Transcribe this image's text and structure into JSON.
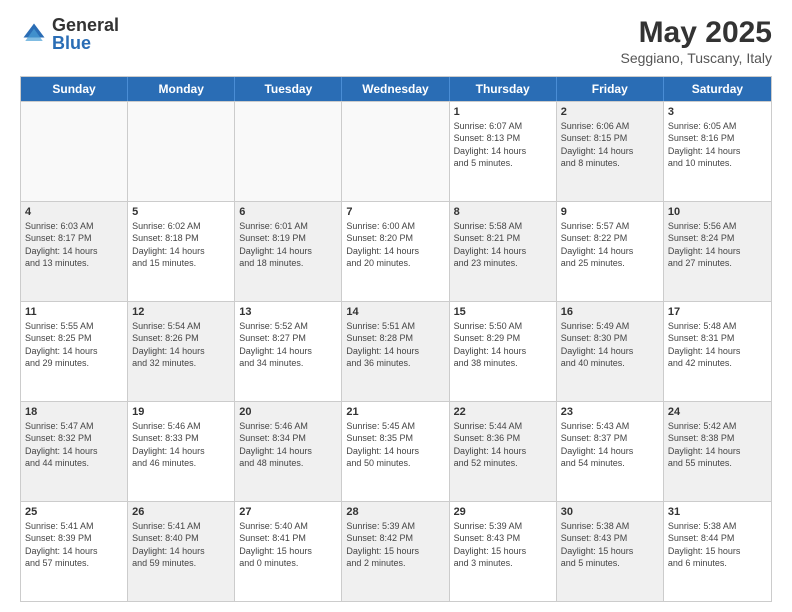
{
  "header": {
    "logo_general": "General",
    "logo_blue": "Blue",
    "title": "May 2025",
    "subtitle": "Seggiano, Tuscany, Italy"
  },
  "calendar": {
    "days": [
      "Sunday",
      "Monday",
      "Tuesday",
      "Wednesday",
      "Thursday",
      "Friday",
      "Saturday"
    ],
    "rows": [
      [
        {
          "num": "",
          "info": "",
          "empty": true
        },
        {
          "num": "",
          "info": "",
          "empty": true
        },
        {
          "num": "",
          "info": "",
          "empty": true
        },
        {
          "num": "",
          "info": "",
          "empty": true
        },
        {
          "num": "1",
          "info": "Sunrise: 6:07 AM\nSunset: 8:13 PM\nDaylight: 14 hours\nand 5 minutes.",
          "shaded": false
        },
        {
          "num": "2",
          "info": "Sunrise: 6:06 AM\nSunset: 8:15 PM\nDaylight: 14 hours\nand 8 minutes.",
          "shaded": true
        },
        {
          "num": "3",
          "info": "Sunrise: 6:05 AM\nSunset: 8:16 PM\nDaylight: 14 hours\nand 10 minutes.",
          "shaded": false
        }
      ],
      [
        {
          "num": "4",
          "info": "Sunrise: 6:03 AM\nSunset: 8:17 PM\nDaylight: 14 hours\nand 13 minutes.",
          "shaded": true
        },
        {
          "num": "5",
          "info": "Sunrise: 6:02 AM\nSunset: 8:18 PM\nDaylight: 14 hours\nand 15 minutes.",
          "shaded": false
        },
        {
          "num": "6",
          "info": "Sunrise: 6:01 AM\nSunset: 8:19 PM\nDaylight: 14 hours\nand 18 minutes.",
          "shaded": true
        },
        {
          "num": "7",
          "info": "Sunrise: 6:00 AM\nSunset: 8:20 PM\nDaylight: 14 hours\nand 20 minutes.",
          "shaded": false
        },
        {
          "num": "8",
          "info": "Sunrise: 5:58 AM\nSunset: 8:21 PM\nDaylight: 14 hours\nand 23 minutes.",
          "shaded": true
        },
        {
          "num": "9",
          "info": "Sunrise: 5:57 AM\nSunset: 8:22 PM\nDaylight: 14 hours\nand 25 minutes.",
          "shaded": false
        },
        {
          "num": "10",
          "info": "Sunrise: 5:56 AM\nSunset: 8:24 PM\nDaylight: 14 hours\nand 27 minutes.",
          "shaded": true
        }
      ],
      [
        {
          "num": "11",
          "info": "Sunrise: 5:55 AM\nSunset: 8:25 PM\nDaylight: 14 hours\nand 29 minutes.",
          "shaded": false
        },
        {
          "num": "12",
          "info": "Sunrise: 5:54 AM\nSunset: 8:26 PM\nDaylight: 14 hours\nand 32 minutes.",
          "shaded": true
        },
        {
          "num": "13",
          "info": "Sunrise: 5:52 AM\nSunset: 8:27 PM\nDaylight: 14 hours\nand 34 minutes.",
          "shaded": false
        },
        {
          "num": "14",
          "info": "Sunrise: 5:51 AM\nSunset: 8:28 PM\nDaylight: 14 hours\nand 36 minutes.",
          "shaded": true
        },
        {
          "num": "15",
          "info": "Sunrise: 5:50 AM\nSunset: 8:29 PM\nDaylight: 14 hours\nand 38 minutes.",
          "shaded": false
        },
        {
          "num": "16",
          "info": "Sunrise: 5:49 AM\nSunset: 8:30 PM\nDaylight: 14 hours\nand 40 minutes.",
          "shaded": true
        },
        {
          "num": "17",
          "info": "Sunrise: 5:48 AM\nSunset: 8:31 PM\nDaylight: 14 hours\nand 42 minutes.",
          "shaded": false
        }
      ],
      [
        {
          "num": "18",
          "info": "Sunrise: 5:47 AM\nSunset: 8:32 PM\nDaylight: 14 hours\nand 44 minutes.",
          "shaded": true
        },
        {
          "num": "19",
          "info": "Sunrise: 5:46 AM\nSunset: 8:33 PM\nDaylight: 14 hours\nand 46 minutes.",
          "shaded": false
        },
        {
          "num": "20",
          "info": "Sunrise: 5:46 AM\nSunset: 8:34 PM\nDaylight: 14 hours\nand 48 minutes.",
          "shaded": true
        },
        {
          "num": "21",
          "info": "Sunrise: 5:45 AM\nSunset: 8:35 PM\nDaylight: 14 hours\nand 50 minutes.",
          "shaded": false
        },
        {
          "num": "22",
          "info": "Sunrise: 5:44 AM\nSunset: 8:36 PM\nDaylight: 14 hours\nand 52 minutes.",
          "shaded": true
        },
        {
          "num": "23",
          "info": "Sunrise: 5:43 AM\nSunset: 8:37 PM\nDaylight: 14 hours\nand 54 minutes.",
          "shaded": false
        },
        {
          "num": "24",
          "info": "Sunrise: 5:42 AM\nSunset: 8:38 PM\nDaylight: 14 hours\nand 55 minutes.",
          "shaded": true
        }
      ],
      [
        {
          "num": "25",
          "info": "Sunrise: 5:41 AM\nSunset: 8:39 PM\nDaylight: 14 hours\nand 57 minutes.",
          "shaded": false
        },
        {
          "num": "26",
          "info": "Sunrise: 5:41 AM\nSunset: 8:40 PM\nDaylight: 14 hours\nand 59 minutes.",
          "shaded": true
        },
        {
          "num": "27",
          "info": "Sunrise: 5:40 AM\nSunset: 8:41 PM\nDaylight: 15 hours\nand 0 minutes.",
          "shaded": false
        },
        {
          "num": "28",
          "info": "Sunrise: 5:39 AM\nSunset: 8:42 PM\nDaylight: 15 hours\nand 2 minutes.",
          "shaded": true
        },
        {
          "num": "29",
          "info": "Sunrise: 5:39 AM\nSunset: 8:43 PM\nDaylight: 15 hours\nand 3 minutes.",
          "shaded": false
        },
        {
          "num": "30",
          "info": "Sunrise: 5:38 AM\nSunset: 8:43 PM\nDaylight: 15 hours\nand 5 minutes.",
          "shaded": true
        },
        {
          "num": "31",
          "info": "Sunrise: 5:38 AM\nSunset: 8:44 PM\nDaylight: 15 hours\nand 6 minutes.",
          "shaded": false
        }
      ]
    ]
  }
}
